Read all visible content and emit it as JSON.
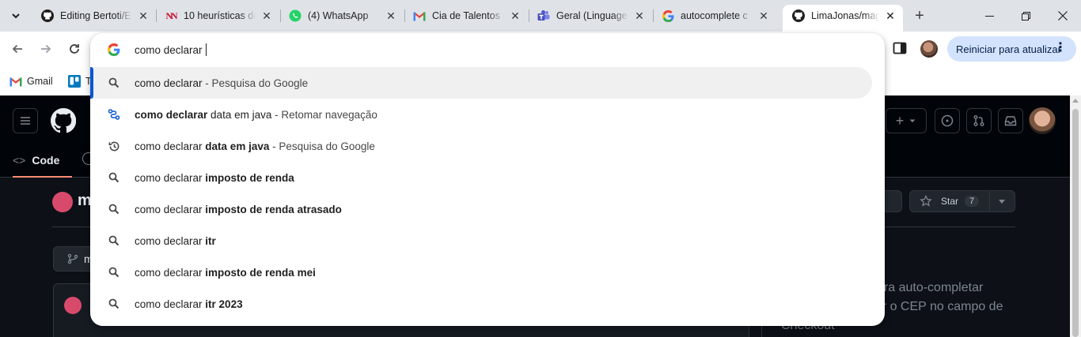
{
  "tabs": [
    {
      "title": "Editing Bertoti/E",
      "favicon": "github-icon",
      "active": false
    },
    {
      "title": "10 heurísticas de",
      "favicon": "nn-icon",
      "active": false
    },
    {
      "title": "(4) WhatsApp",
      "favicon": "whatsapp-icon",
      "active": false
    },
    {
      "title": "Cia de Talentos |",
      "favicon": "gmail-icon",
      "active": false
    },
    {
      "title": "Geral (Linguage",
      "favicon": "teams-icon",
      "active": false
    },
    {
      "title": "autocomplete c",
      "favicon": "google-icon",
      "active": false
    },
    {
      "title": "LimaJonas/mag",
      "favicon": "github-icon",
      "active": true
    }
  ],
  "toolbar": {
    "update_label": "Reiniciar para atualizar",
    "update_menu": "⋮"
  },
  "bookmarks": [
    {
      "label": "Gmail",
      "icon": "gmail-icon"
    },
    {
      "label": "T",
      "icon": "trello-icon"
    }
  ],
  "omnibox": {
    "query": "como declarar ",
    "suggestions": [
      {
        "icon": "search-icon",
        "prefix": "como declarar",
        "bold": "",
        "desc": " - Pesquisa do Google",
        "selected": true
      },
      {
        "icon": "journey-icon",
        "prefix": "",
        "bold": "como declarar",
        "rest": " data em java",
        "desc": " - Retomar navegação",
        "selected": false
      },
      {
        "icon": "history-icon",
        "prefix": "como declarar ",
        "bold": "data em java",
        "desc": " - Pesquisa do Google",
        "selected": false
      },
      {
        "icon": "search-icon",
        "prefix": "como declarar ",
        "bold": "imposto de renda",
        "desc": "",
        "selected": false
      },
      {
        "icon": "search-icon",
        "prefix": "como declarar ",
        "bold": "imposto de renda atrasado",
        "desc": "",
        "selected": false
      },
      {
        "icon": "search-icon",
        "prefix": "como declarar ",
        "bold": "itr",
        "desc": "",
        "selected": false
      },
      {
        "icon": "search-icon",
        "prefix": "como declarar ",
        "bold": "imposto de renda mei",
        "desc": "",
        "selected": false
      },
      {
        "icon": "search-icon",
        "prefix": "como declarar ",
        "bold": "itr 2023",
        "desc": "",
        "selected": false
      }
    ]
  },
  "github": {
    "code_tab": "Code",
    "repo_name_visible": "m",
    "branch_visible": "m",
    "star_label": "Star",
    "star_count": "7",
    "about_lines": [
      "ara auto-completar",
      "her o CEP no campo de",
      "Checkout"
    ]
  },
  "colors": {
    "accent": "#0b57d0",
    "update_bg": "#d3e3fd",
    "github_bg": "#0d1117",
    "github_header": "#010409",
    "code_tab_underline": "#fd8c73"
  }
}
